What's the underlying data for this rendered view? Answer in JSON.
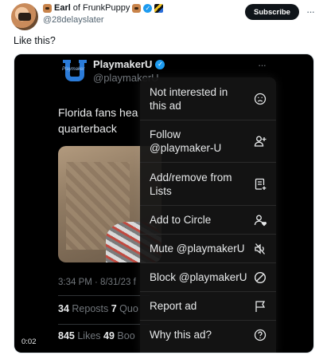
{
  "author": {
    "name": "Earl",
    "name_suffix": "of FrunkPuppy",
    "handle": "@28delayslater",
    "verified": true
  },
  "subscribe_label": "Subscribe",
  "more_label": "···",
  "post_text": "Like this?",
  "embedded": {
    "logo_text": "Playmaker",
    "name": "PlaymakerU",
    "handle": "@playmakerU",
    "more_label": "···",
    "text_line1": "Florida fans hea",
    "text_line2": "quarterback",
    "timestamp": "3:34 PM · 8/31/23 f",
    "reposts_count": "34",
    "reposts_label": "Reposts",
    "quotes_count": "7",
    "quotes_label": "Quo",
    "likes_count": "845",
    "likes_label": "Likes",
    "bookmarks_count": "49",
    "bookmarks_label": "Boo",
    "duration": "0:02"
  },
  "menu": {
    "items": [
      {
        "label": "Not interested in this ad",
        "icon": "frown-face-icon"
      },
      {
        "label": "Follow @playmaker-U",
        "icon": "person-add-icon"
      },
      {
        "label": "Add/remove from Lists",
        "icon": "list-add-icon"
      },
      {
        "label": "Add to Circle",
        "icon": "person-heart-icon"
      },
      {
        "label": "Mute @playmakerU",
        "icon": "mute-speaker-icon"
      },
      {
        "label": "Block @playmakerU",
        "icon": "block-icon"
      },
      {
        "label": "Report ad",
        "icon": "flag-icon"
      },
      {
        "label": "Why this ad?",
        "icon": "question-icon"
      }
    ]
  },
  "colors": {
    "accent_blue": "#1d9bf0",
    "dark_bg": "#000000",
    "menu_text": "#e7e9ea"
  }
}
